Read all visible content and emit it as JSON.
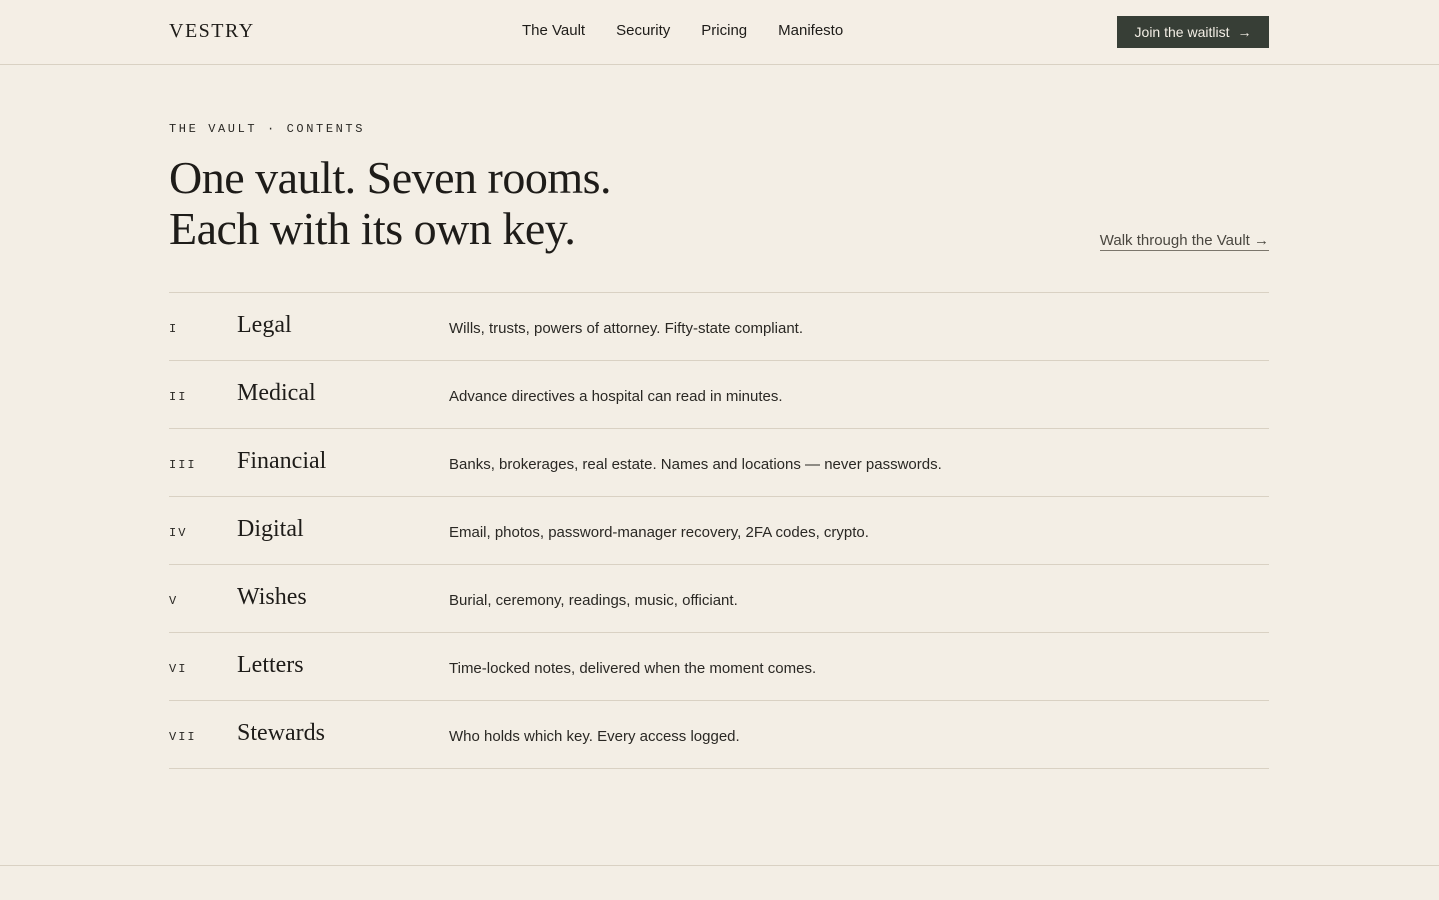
{
  "header": {
    "brand": "VESTRY",
    "nav": [
      {
        "label": "The Vault"
      },
      {
        "label": "Security"
      },
      {
        "label": "Pricing"
      },
      {
        "label": "Manifesto"
      }
    ],
    "cta_label": "Join the waitlist",
    "cta_arrow": "→"
  },
  "hero": {
    "eyebrow": "THE VAULT · CONTENTS",
    "headline_line1": "One vault. Seven rooms.",
    "headline_line2": "Each with its own key.",
    "walk_link": "Walk through the Vault →"
  },
  "rooms": [
    {
      "num": "I",
      "name": "Legal",
      "desc": "Wills, trusts, powers of attorney. Fifty-state compliant."
    },
    {
      "num": "II",
      "name": "Medical",
      "desc": "Advance directives a hospital can read in minutes."
    },
    {
      "num": "III",
      "name": "Financial",
      "desc": "Banks, brokerages, real estate. Names and locations — never passwords."
    },
    {
      "num": "IV",
      "name": "Digital",
      "desc": "Email, photos, password-manager recovery, 2FA codes, crypto."
    },
    {
      "num": "V",
      "name": "Wishes",
      "desc": "Burial, ceremony, readings, music, officiant."
    },
    {
      "num": "VI",
      "name": "Letters",
      "desc": "Time-locked notes, delivered when the moment comes."
    },
    {
      "num": "VII",
      "name": "Stewards",
      "desc": "Who holds which key. Every access logged."
    }
  ],
  "colors": {
    "background": "#f3eee5",
    "text": "#1e1c19",
    "cta_background": "#373e36",
    "divider": "#d9d1c3"
  }
}
